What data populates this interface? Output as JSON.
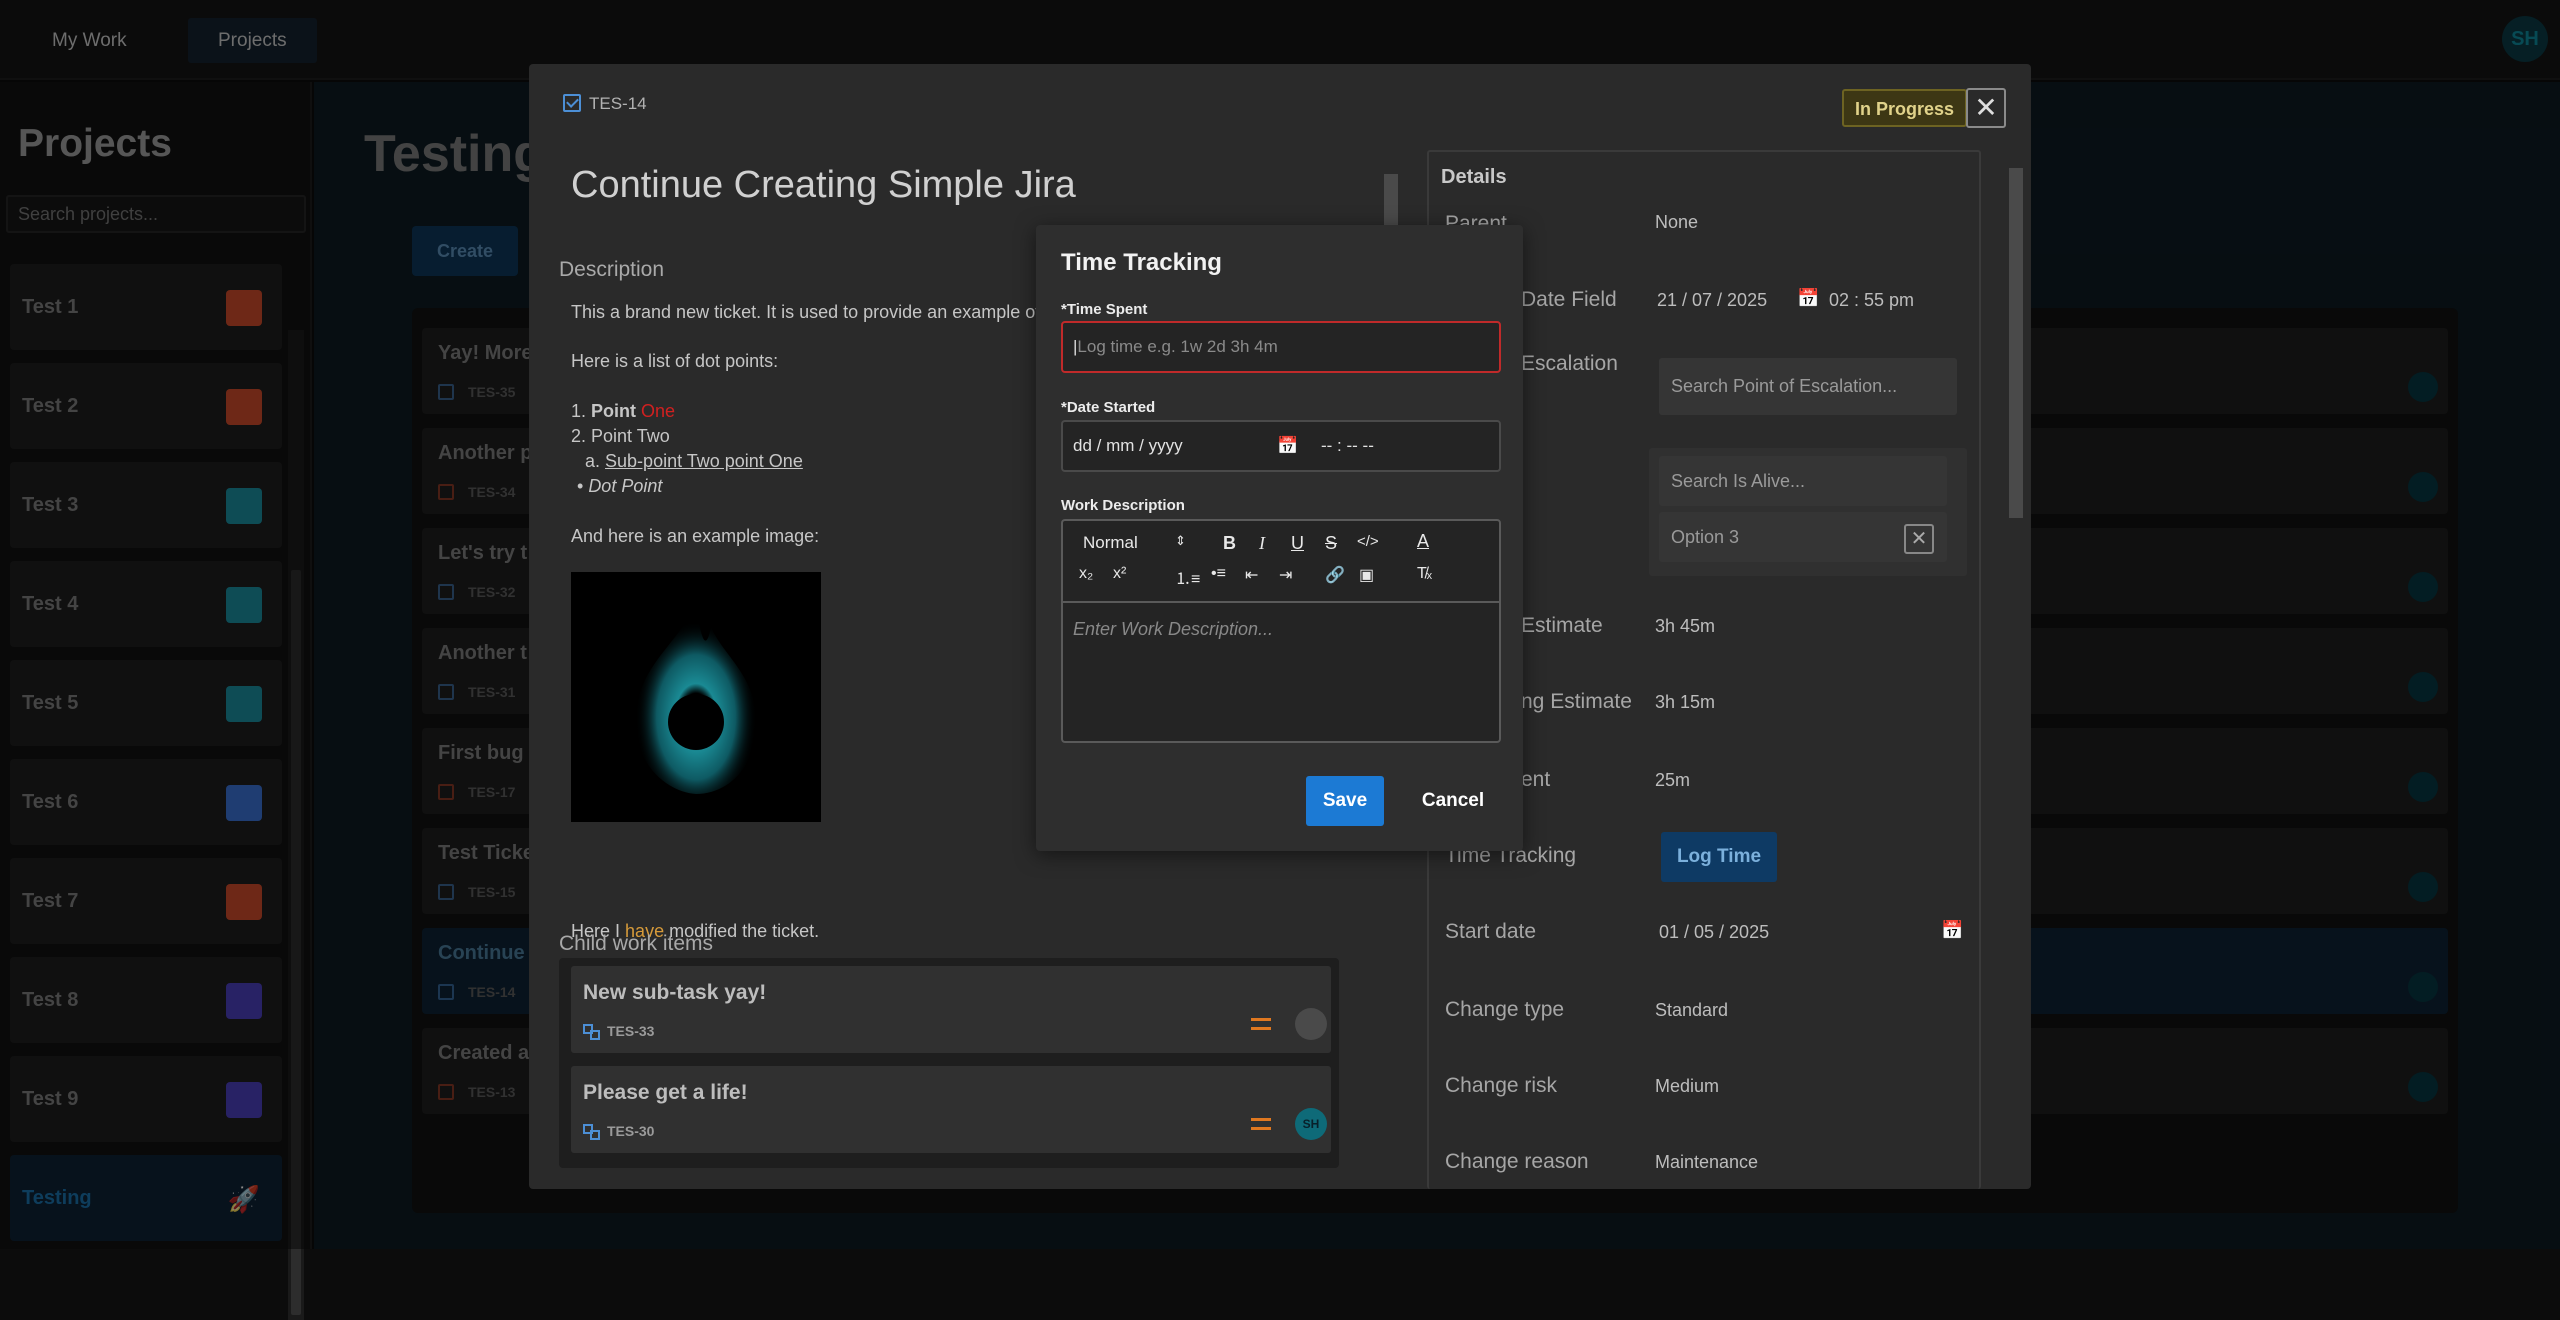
{
  "nav": {
    "my_work": "My Work",
    "projects": "Projects",
    "avatar": "SH"
  },
  "sidebar": {
    "title": "Projects",
    "search_placeholder": "Search projects...",
    "items": [
      {
        "label": "Test 1",
        "icon": "rocket-icon",
        "color": "#c94a2a"
      },
      {
        "label": "Test 2",
        "icon": "rocket-icon",
        "color": "#c94a2a"
      },
      {
        "label": "Test 3",
        "icon": "calendar-icon",
        "color": "#1a8a9c"
      },
      {
        "label": "Test 4",
        "icon": "calendar-icon",
        "color": "#1a8a9c"
      },
      {
        "label": "Test 5",
        "icon": "calendar-icon",
        "color": "#1a8a9c"
      },
      {
        "label": "Test 6",
        "icon": "cloud-icon",
        "color": "#3a6fd0"
      },
      {
        "label": "Test 7",
        "icon": "window-icon",
        "color": "#c94a2a"
      },
      {
        "label": "Test 8",
        "icon": "palette-icon",
        "color": "#4a3fb8"
      },
      {
        "label": "Test 9",
        "icon": "palette-icon",
        "color": "#4a3fb8"
      },
      {
        "label": "Testing",
        "icon": "rocket-icon",
        "color": "#1a3a5a"
      }
    ]
  },
  "main": {
    "title": "Testing",
    "create_label": "Create"
  },
  "board_rows": [
    {
      "title": "Yay! More",
      "key": "TES-35"
    },
    {
      "title": "Another p",
      "key": "TES-34"
    },
    {
      "title": "Let's try t",
      "key": "TES-32"
    },
    {
      "title": "Another t",
      "key": "TES-31"
    },
    {
      "title": "First bug",
      "key": "TES-17"
    },
    {
      "title": "Test Ticke",
      "key": "TES-15"
    },
    {
      "title": "Continue",
      "key": "TES-14"
    },
    {
      "title": "Created a",
      "key": "TES-13"
    }
  ],
  "ticket": {
    "key": "TES-14",
    "status": "In Progress",
    "title": "Continue Creating Simple Jira",
    "description_label": "Description",
    "description": {
      "intro": "This a brand new ticket. It is used to provide an example of t",
      "list_intro": "Here is a list of dot points:",
      "point_one_num": "1.",
      "point_one_a": "Point",
      "point_one_b": "One",
      "point_two": "2. Point Two",
      "sub_point_num": "a.",
      "sub_point": "Sub-point Two point One",
      "dot_point": "Dot Point",
      "image_intro": "And here is an example image:",
      "modified_a": "Here I",
      "modified_b": "have",
      "modified_c": "modified the ticket."
    },
    "child_label": "Child work items",
    "children": [
      {
        "title": "New sub-task yay!",
        "key": "TES-33"
      },
      {
        "title": "Please get a life!",
        "key": "TES-30",
        "avatar": "SH"
      }
    ]
  },
  "details": {
    "heading": "Details",
    "parent_label": "Parent",
    "parent_value": "None",
    "date_field_label": "Date Field",
    "date_field_value": "21 / 07 / 2025",
    "date_field_time": "02 : 55   pm",
    "escalation_label": "Escalation",
    "escalation_placeholder": "Search Point of Escalation...",
    "is_alive_placeholder": "Search Is Alive...",
    "is_alive_option": "Option 3",
    "estimate_label": "Estimate",
    "estimate_value": "3h 45m",
    "remaining_label": "ng Estimate",
    "remaining_value": "3h 15m",
    "spent_label": "ent",
    "spent_value": "25m",
    "time_tracking_label": "Time Tracking",
    "log_time": "Log Time",
    "start_date_label": "Start date",
    "start_date_value": "01 / 05 / 2025",
    "change_type_label": "Change type",
    "change_type_value": "Standard",
    "change_risk_label": "Change risk",
    "change_risk_value": "Medium",
    "change_reason_label": "Change reason",
    "change_reason_value": "Maintenance"
  },
  "time_tracking": {
    "title": "Time Tracking",
    "time_spent_label": "*Time Spent",
    "time_spent_placeholder": "Log time e.g. 1w 2d 3h 4m",
    "date_started_label": "*Date Started",
    "date_placeholder": "dd / mm / yyyy",
    "time_placeholder": "-- : --   --",
    "work_desc_label": "Work Description",
    "heading_select": "Normal",
    "editor_placeholder": "Enter Work Description...",
    "save": "Save",
    "cancel": "Cancel"
  },
  "colors": {
    "accent": "#1c7ad4",
    "error": "#c02a2a",
    "priority": "#e07820",
    "status": "#e0d28a"
  }
}
